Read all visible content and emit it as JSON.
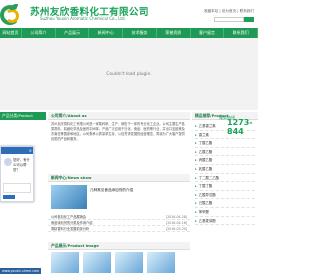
{
  "header": {
    "company_cn": "苏州友欣香料化工有限公司",
    "company_en": "Suzhou Youxin Aromatic Chemical Co., Ltd.",
    "top_links": "收藏本站 | 设为首页 | 联系我们"
  },
  "nav": {
    "items": [
      "网站首页",
      "公司简介",
      "产品展示",
      "新闻中心",
      "技术服务",
      "荣誉资质",
      "客户留言",
      "联系我们"
    ]
  },
  "banner": {
    "message": "Couldn't load plugin."
  },
  "left": {
    "category_title": "产品分类/Product",
    "chat_text": "您好，有什么可以帮您？"
  },
  "about": {
    "title": "公司简介/About us",
    "text": "苏州友欣香料化工有限公司是一家集科研、生产、销售于一体的专业化工企业。公司主要生产各类香料、精细化学品及医药中间体，产品广泛应用于日化、食品、医药等行业，并出口至欧美及东南亚等国家和地区。公司秉承以质量求生存、以信誉求发展的经营理念，竭诚为广大客户提供优质的产品和服务。"
  },
  "news": {
    "title": "新闻中心/News show",
    "headline": "几种常见食品添加剂的介绍",
    "rows": [
      {
        "text": "公司参加化工产品展销会",
        "date": "[2016-04-28]"
      },
      {
        "text": "食品添加剂的分类及作用介绍",
        "date": "[2016-04-16]"
      },
      {
        "text": "香精香料行业发展前景分析",
        "date": "[2016-03-20]"
      }
    ]
  },
  "product_images": {
    "title": "产品展示/Product Image"
  },
  "right": {
    "title": "精品推荐/Product",
    "categories": [
      "乙基香兰素",
      "香兰素",
      "丁酸乙酯",
      "乙酸乙酯",
      "丙酸乙酯",
      "乳酸乙酯",
      "丁二酸二乙酯",
      "丁酸丁酯",
      "乙酸异戊酯",
      "己酸乙酯",
      "苯甲醛",
      "乙基麦芽酚"
    ],
    "phone_prefix": "服务热线",
    "phone_number": "1273-844"
  },
  "ad": {
    "text": "纯"
  },
  "footer": {
    "url": "www.youxin-chem.com"
  },
  "colors": {
    "primary_green": "#1f9a56",
    "logo_yellow": "#e8b400",
    "chat_blue": "#2e6db7"
  }
}
